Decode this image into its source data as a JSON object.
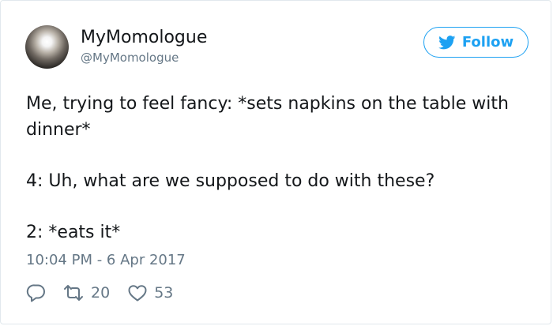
{
  "tweet": {
    "display_name": "MyMomologue",
    "handle": "@MyMomologue",
    "follow_label": "Follow",
    "text_lines": [
      "Me, trying to feel fancy: *sets napkins on the table with dinner*",
      "4: Uh, what are we supposed to do with these?",
      "2: *eats it*"
    ],
    "timestamp": "10:04 PM - 6 Apr 2017",
    "retweet_count": "20",
    "like_count": "53"
  },
  "icons": {
    "follow_button": "twitter-bird-icon",
    "reply": "reply-icon",
    "retweet": "retweet-icon",
    "like": "heart-icon"
  },
  "colors": {
    "accent": "#1da1f2",
    "text": "#14171a",
    "muted": "#657786",
    "border": "#e1e8ed"
  }
}
